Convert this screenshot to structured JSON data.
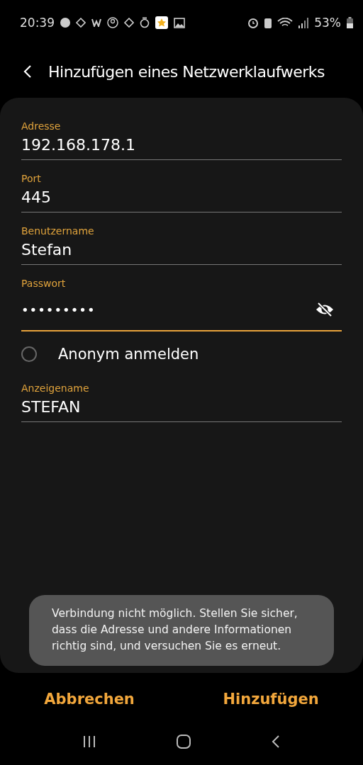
{
  "status_bar": {
    "time": "20:39",
    "battery": "53%"
  },
  "header": {
    "title": "Hinzufügen eines Netzwerklaufwerks"
  },
  "fields": [
    {
      "kind": "text",
      "label": "Adresse",
      "value": "192.168.178.1",
      "focused": false
    },
    {
      "kind": "text",
      "label": "Port",
      "value": "445",
      "focused": false
    },
    {
      "kind": "text",
      "label": "Benutzername",
      "value": "Stefan",
      "focused": false
    },
    {
      "kind": "password",
      "label": "Passwort",
      "value": "•••••••••",
      "focused": true
    },
    {
      "kind": "radio",
      "label": "Anonym anmelden",
      "checked": false
    },
    {
      "kind": "text",
      "label": "Anzeigename",
      "value": "STEFAN",
      "focused": false
    }
  ],
  "toast": "Verbindung nicht möglich. Stellen Sie sicher, dass die Adresse und andere Informationen richtig sind, und versuchen Sie es erneut.",
  "buttons": [
    "Abbrechen",
    "Hinzufügen"
  ]
}
